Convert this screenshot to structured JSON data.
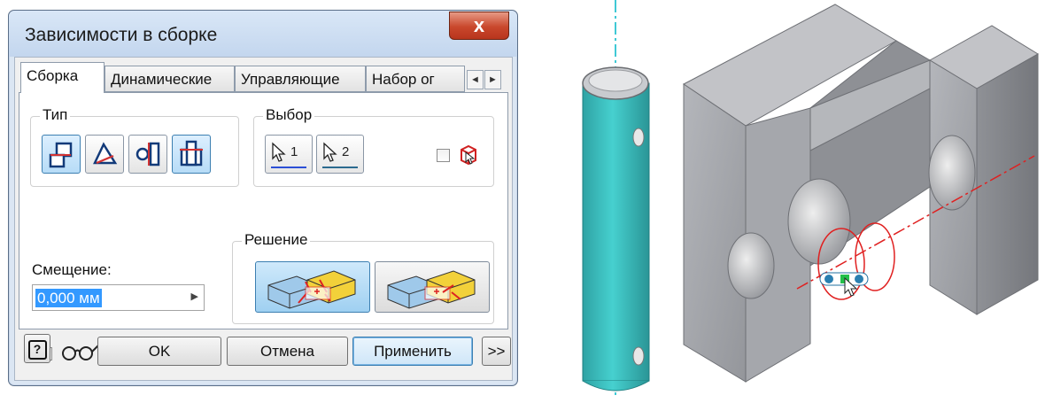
{
  "dialog": {
    "title": "Зависимости в сборке",
    "close_glyph": "x",
    "tabs": [
      {
        "label": "Сборка",
        "active": true
      },
      {
        "label": "Динамические",
        "active": false
      },
      {
        "label": "Управляющие",
        "active": false
      },
      {
        "label": "Набор ог",
        "active": false
      }
    ],
    "tab_scroll": [
      "◄",
      "►"
    ],
    "type_group": {
      "label": "Тип"
    },
    "selection_group": {
      "label": "Выбор",
      "buttons": [
        {
          "number": "1",
          "color": "#2b4fd6"
        },
        {
          "number": "2",
          "color": "#2b6a8f"
        }
      ],
      "checkbox_checked": false
    },
    "offset": {
      "label": "Смещение:",
      "value": "0,000 мм"
    },
    "preview_checkbox_checked": true,
    "predict_checkbox_checked": false,
    "solution_group": {
      "label": "Решение",
      "selected_index": 0
    },
    "buttons": {
      "help": "?",
      "ok": "OK",
      "cancel": "Отмена",
      "apply": "Применить",
      "more": ">>"
    }
  },
  "viewport": {
    "pin_color": "#3bc1c0",
    "block_color": "#a7a8ad",
    "axis_color": "#00b7c7",
    "constraint_axis_color": "#e02020"
  }
}
